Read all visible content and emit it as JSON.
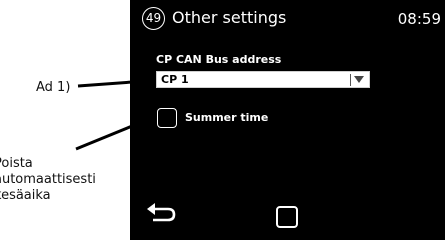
{
  "callouts": {
    "ad": "Ad 1)",
    "summer_lines": [
      "Poista",
      "automaattisesti",
      "kesäaika"
    ]
  },
  "header": {
    "page_number": "49",
    "title": "Other settings",
    "time": "08:59"
  },
  "can_bus": {
    "label": "CP CAN Bus address",
    "value": "CP 1"
  },
  "summer_time": {
    "label": "Summer time",
    "checked": false
  },
  "nav": {
    "back_icon": "back-arrow-icon",
    "home_icon": "home-square-icon"
  },
  "colors": {
    "screen_bg": "#000000",
    "screen_text": "#ffffff",
    "select_bg": "#ffffff"
  }
}
